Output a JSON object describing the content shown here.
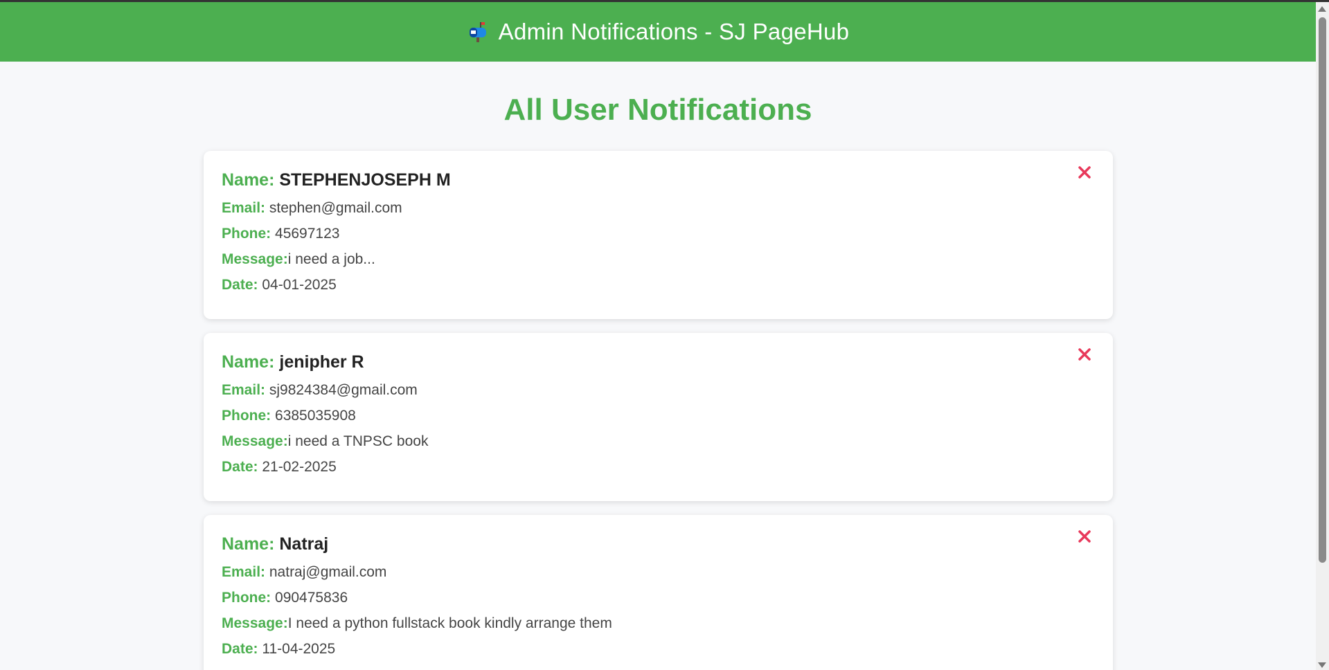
{
  "header": {
    "icon": "mailbox-icon",
    "title": "Admin Notifications - SJ PageHub"
  },
  "page_title": "All User Notifications",
  "labels": {
    "name": "Name:",
    "email": "Email:",
    "phone": "Phone:",
    "message": "Message:",
    "date": "Date:"
  },
  "notifications": [
    {
      "name": "STEPHENJOSEPH M",
      "email": "stephen@gmail.com",
      "phone": "45697123",
      "message": "i need a job...",
      "date": "04-01-2025"
    },
    {
      "name": "jenipher R",
      "email": "sj9824384@gmail.com",
      "phone": "6385035908",
      "message": "i need a TNPSC book",
      "date": "21-02-2025"
    },
    {
      "name": "Natraj",
      "email": "natraj@gmail.com",
      "phone": "090475836",
      "message": "I need a python fullstack book kindly arrange them",
      "date": "11-04-2025"
    }
  ],
  "colors": {
    "brand_green": "#4caf50",
    "delete_red": "#e8385a"
  }
}
